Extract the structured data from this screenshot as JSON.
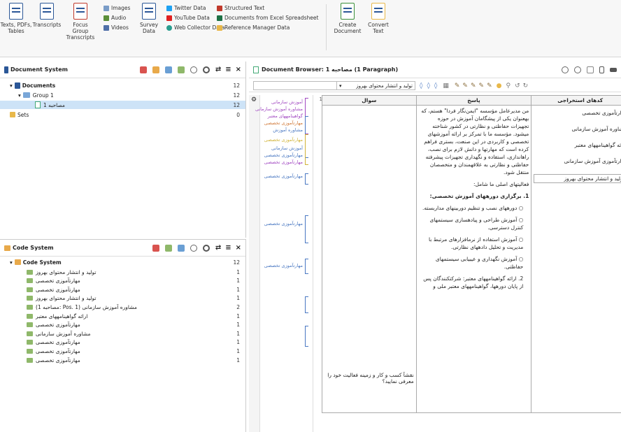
{
  "ribbon": {
    "big_buttons": [
      {
        "label": "Texts, PDFs, Tables",
        "icon": "import-document-icon"
      },
      {
        "label": "Transcripts",
        "icon": "transcript-icon"
      },
      {
        "label": "Focus Group Transcripts",
        "icon": "focus-group-icon"
      },
      {
        "label": "Survey Data",
        "icon": "survey-data-icon"
      },
      {
        "label": "Create Document",
        "icon": "create-document-icon"
      },
      {
        "label": "Convert Text",
        "icon": "convert-text-icon"
      }
    ],
    "small_media": [
      "Images",
      "Audio",
      "Videos"
    ],
    "small_web": [
      "Twitter Data",
      "YouTube Data",
      "Web Collector Data"
    ],
    "small_struct": [
      "Structured Text",
      "Documents from Excel Spreadsheet",
      "Reference Manager Data"
    ]
  },
  "document_system": {
    "title": "Document System",
    "rows": [
      {
        "label": "Documents",
        "count": "12"
      },
      {
        "label": "Group 1",
        "count": "12"
      },
      {
        "label": "مصاحبه 1",
        "count": "12"
      },
      {
        "label": "Sets",
        "count": "0"
      }
    ]
  },
  "code_system": {
    "title": "Code System",
    "root": {
      "label": "Code System",
      "count": "12"
    },
    "codes": [
      {
        "label": "تولید و انتشار محتوای بهروز",
        "count": "1"
      },
      {
        "label": "مهارتآموزی تخصصی",
        "count": "1"
      },
      {
        "label": "مهارتآموزی تخصصی",
        "count": "1"
      },
      {
        "label": "تولید و انتشار محتوای بهروز",
        "count": "1"
      },
      {
        "label": "(مصاحبه 1: Pos. 1) مشاوره آموزش سازمانی",
        "count": "2"
      },
      {
        "label": "ارائه گواهینامههای معتبر",
        "count": "1"
      },
      {
        "label": "مهارتآموزی تخصصی",
        "count": "1"
      },
      {
        "label": "مشاوره آموزش سازمانی",
        "count": "1"
      },
      {
        "label": "مهارتآموزی تخصصی",
        "count": "1"
      },
      {
        "label": "مهارتآموزی تخصصی",
        "count": "1"
      },
      {
        "label": "مهارتآموزی تخصصی",
        "count": "1"
      }
    ]
  },
  "document_browser": {
    "title": "Document Browser: مصاحبه 1  (1 Paragraph)",
    "code_dropdown": "تولید و انتشار محتوای بهروز",
    "columns": [
      "سوال",
      "پاسخ",
      "کدهای استخراجی"
    ],
    "question": "نقشآ کسب و کار و زمینه فعالیت خود را معرفی نمایید؟",
    "answer_paragraphs": [
      "من مدیرعامل مؤسسه \"ایمن‌نگار فردا\" هستم، که بهعنوان یکی از پیشگامان آموزش در حوزه تجهیزات حفاظتی و نظارتی در کشور شناخته میشود. مؤسسه ما با تمرکز بر ارائه آموزشهای تخصصی و کاربردی در این صنعت، بستری فراهم کرده است که مهارتها و دانش لازم برای نصب، راهاندازی، استفاده و نگهداری تجهیزات پیشرفته حفاظتی و نظارتی به علاقهمندان و متخصصان منتقل شود.",
      "فعالیتهای اصلی ما شامل:",
      "1. برگزاری دورههای آموزش تخصصی:",
      "○ دورههای نصب و تنظیم دوربینهای مداربسته.",
      "○ آموزش طراحی و پیادهسازی سیستمهای کنترل دسترسی.",
      "○ آموزش استفاده از نرمافزارهای مرتبط با مدیریت و تحلیل دادههای نظارتی.",
      "○ آموزش نگهداری و عیبیابی سیستمهای حفاظتی.",
      "2. ارائه گواهینامههای معتبر: شرکتکنندگان پس از پایان دورهها، گواهینامههای معتبر ملی و"
    ],
    "extracted_codes": [
      "مهارتآموزی تخصصی",
      "مشاوره آموزش سازمانی",
      "ارائه گواهینامههای معتبر",
      "مهارتآموزی آموزش سازمانی",
      "تولید و انتشار محتوای بهروز"
    ],
    "margin_codes": [
      "آموزش سازمانی",
      "مشاوره آموزش سازمانی",
      "گواهینامههای معتبر",
      "مهارتآموزی تخصصی",
      "مشاوره آموزش",
      "مهارتآموزی تخصصی",
      "آموزش سازمانی",
      "مهارتآموزی تخصصی",
      "مهارتآموزی تخصصی",
      "مهارتآموزی تخصصی",
      "مهارتآموزی تخصصی",
      "مهارتآموزی تخصصی"
    ],
    "paragraph_number": "1"
  },
  "colors": {
    "accent_blue": "#2b5797",
    "code_green": "#8fb86a",
    "folder_yellow": "#e8b84a",
    "code_link": "#4a78c2",
    "selected_row": "#cde3f7"
  }
}
